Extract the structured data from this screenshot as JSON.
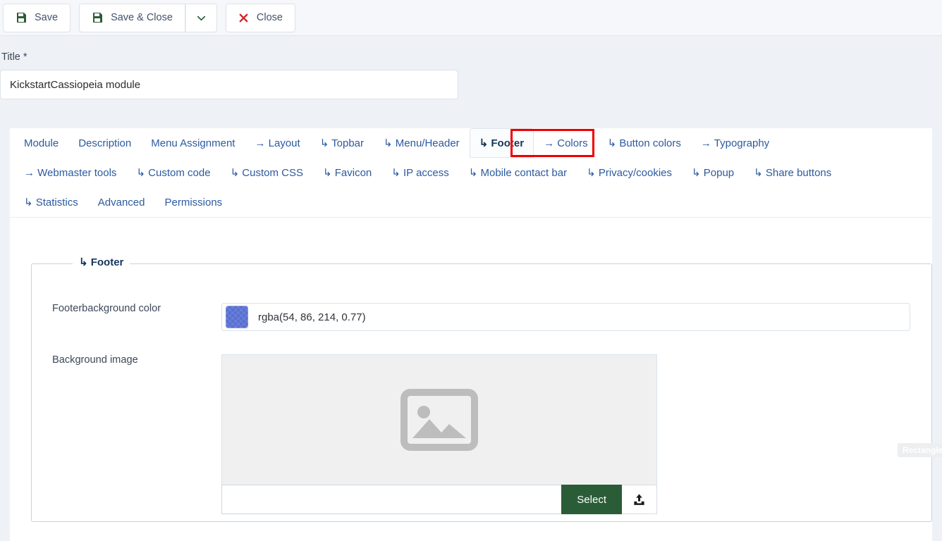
{
  "toolbar": {
    "save_label": "Save",
    "save_close_label": "Save & Close",
    "close_label": "Close",
    "caret_icon": "chevron-down-icon",
    "save_icon": "floppy-disk-icon",
    "close_icon": "x-mark-icon",
    "save_icon_color": "#2b5c38",
    "close_icon_color": "#c9282d"
  },
  "title_field": {
    "label": "Title *",
    "value": "KickstartCassiopeia module"
  },
  "tabs": {
    "active": "↳ Footer",
    "rows": [
      [
        {
          "label": "Module"
        },
        {
          "label": "Description"
        },
        {
          "label": "Menu Assignment"
        },
        {
          "label": "→ Layout"
        },
        {
          "label": "↳ Topbar"
        },
        {
          "label": "↳ Menu/Header"
        },
        {
          "label": "↳ Footer"
        },
        {
          "label": "→ Colors"
        },
        {
          "label": "↳ Button colors"
        },
        {
          "label": "→ Typography"
        }
      ],
      [
        {
          "label": "→ Webmaster tools"
        },
        {
          "label": "↳ Custom code"
        },
        {
          "label": "↳ Custom CSS"
        },
        {
          "label": "↳ Favicon"
        },
        {
          "label": "↳ IP access"
        },
        {
          "label": "↳ Mobile contact bar"
        },
        {
          "label": "↳ Privacy/cookies"
        },
        {
          "label": "↳ Popup"
        },
        {
          "label": "↳ Share buttons"
        }
      ],
      [
        {
          "label": "↳ Statistics"
        },
        {
          "label": "Advanced"
        },
        {
          "label": "Permissions"
        }
      ]
    ]
  },
  "fieldset": {
    "legend": "↳ Footer",
    "color_field": {
      "label": "Footerbackground color",
      "value": "rgba(54, 86, 214, 0.77)",
      "swatch_color": "rgba(54, 86, 214, 0.77)"
    },
    "background_image": {
      "label": "Background image",
      "placeholder": "",
      "value": "",
      "preview_icon": "image-placeholder-icon",
      "select_label": "Select",
      "upload_icon": "upload-icon",
      "select_button_color": "#2b5c38"
    }
  },
  "annotations": {
    "rectangle_tag": "Rectangle",
    "highlight_color": "#ee0000",
    "highlight_target": "↳ Footer"
  }
}
